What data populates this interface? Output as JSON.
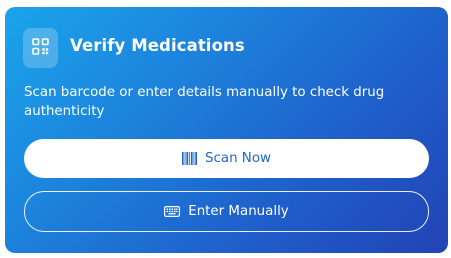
{
  "card": {
    "title": "Verify Medications",
    "description": "Scan barcode or enter details manually to check drug authenticity",
    "icon": "qr-code-icon"
  },
  "actions": {
    "scan_label": "Scan Now",
    "scan_icon": "barcode-icon",
    "manual_label": "Enter Manually",
    "manual_icon": "keyboard-icon"
  },
  "colors": {
    "gradient_start": "#1aa4ea",
    "gradient_end": "#2243b5",
    "scan_text": "#1f66cc"
  }
}
